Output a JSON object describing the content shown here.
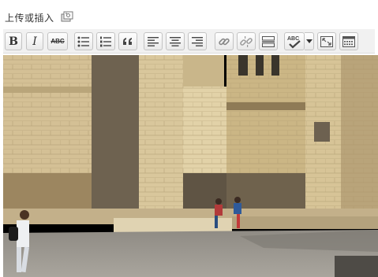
{
  "upload": {
    "label": "上传或插入",
    "icon": "add-media-icon"
  },
  "toolbar": {
    "bold_label": "B",
    "italic_label": "I",
    "strike_label": "ABC",
    "spellcheck_label": "ABC",
    "buttons": [
      {
        "name": "bold-button",
        "icon": "bold-icon"
      },
      {
        "name": "italic-button",
        "icon": "italic-icon"
      },
      {
        "name": "strikethrough-button",
        "icon": "strikethrough-icon"
      },
      {
        "name": "bulleted-list-button",
        "icon": "bulleted-list-icon"
      },
      {
        "name": "numbered-list-button",
        "icon": "numbered-list-icon"
      },
      {
        "name": "blockquote-button",
        "icon": "blockquote-icon"
      },
      {
        "name": "align-left-button",
        "icon": "align-left-icon"
      },
      {
        "name": "align-center-button",
        "icon": "align-center-icon"
      },
      {
        "name": "align-right-button",
        "icon": "align-right-icon"
      },
      {
        "name": "insert-link-button",
        "icon": "link-icon"
      },
      {
        "name": "remove-link-button",
        "icon": "unlink-icon"
      },
      {
        "name": "insert-more-button",
        "icon": "more-tag-icon"
      },
      {
        "name": "spellcheck-button",
        "icon": "spellcheck-icon"
      },
      {
        "name": "fullscreen-button",
        "icon": "fullscreen-icon"
      },
      {
        "name": "kitchen-sink-button",
        "icon": "kitchen-sink-icon"
      }
    ]
  },
  "colors": {
    "toolbar_bg": "#f1f1f1",
    "button_border": "#c3c3c3",
    "stone_light": "#d8c69a",
    "stone_shadow": "#5a5347",
    "sky": "#000000"
  },
  "editor": {
    "image": "photo-stone-building-courtyard"
  }
}
